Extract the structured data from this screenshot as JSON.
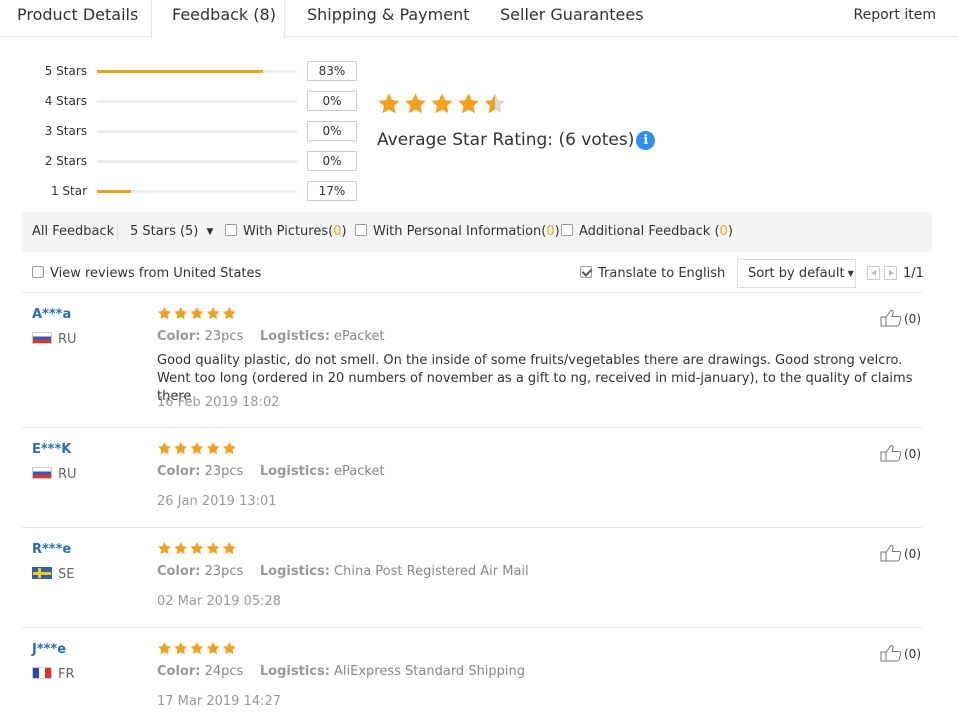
{
  "tabs": [
    {
      "label": "Product Details"
    },
    {
      "label": "Feedback (8)"
    },
    {
      "label": "Shipping & Payment"
    },
    {
      "label": "Seller Guarantees"
    }
  ],
  "report_item": "Report item",
  "rating_distribution": [
    {
      "label": "5 Stars",
      "percent_text": "83%",
      "fraction": 0.83
    },
    {
      "label": "4 Stars",
      "percent_text": "0%",
      "fraction": 0.0
    },
    {
      "label": "3 Stars",
      "percent_text": "0%",
      "fraction": 0.0
    },
    {
      "label": "2 Stars",
      "percent_text": "0%",
      "fraction": 0.0
    },
    {
      "label": "1 Star",
      "percent_text": "17%",
      "fraction": 0.17
    }
  ],
  "average": {
    "label": "Average Star Rating:",
    "votes": "(6 votes)",
    "star_value": 4.5,
    "info_icon": "i"
  },
  "filters": {
    "all_feedback": "All Feedback",
    "star_select": "5 Stars (5)",
    "with_pictures": {
      "label": "With Pictures",
      "count": "0",
      "checked": false
    },
    "with_personal_info": {
      "label": "With Personal Information",
      "count": "0",
      "checked": false
    },
    "additional_feedback": {
      "label": "Additional Feedback",
      "count": "0",
      "checked": false
    }
  },
  "options": {
    "view_country": {
      "label": "View reviews from United States",
      "checked": false
    },
    "translate": {
      "label": "Translate to English",
      "checked": true
    },
    "sort": "Sort by default",
    "page": "1/1"
  },
  "colors": {
    "star": "#f3a01c",
    "star_empty": "#d9d9d9",
    "username": "#2a6db4",
    "info": "#2e8def"
  },
  "reviews": [
    {
      "user": "A***a",
      "country": "RU",
      "flag": "russia-flag",
      "stars": 5,
      "color_label": "Color:",
      "color_value": "23pcs",
      "logistics_label": "Logistics:",
      "logistics_value": "ePacket",
      "text": "Good quality plastic, do not smell. On the inside of some fruits/vegetables there are drawings. Good strong velcro. Went too long (ordered in 20 numbers of november as a gift to ng, received in mid-january), to the quality of claims there",
      "date": "16 Feb 2019 18:02",
      "likes": "(0)"
    },
    {
      "user": "E***K",
      "country": "RU",
      "flag": "russia-flag",
      "stars": 5,
      "color_label": "Color:",
      "color_value": "23pcs",
      "logistics_label": "Logistics:",
      "logistics_value": "ePacket",
      "text": "",
      "date": "26 Jan 2019 13:01",
      "likes": "(0)"
    },
    {
      "user": "R***e",
      "country": "SE",
      "flag": "sweden-flag",
      "stars": 5,
      "color_label": "Color:",
      "color_value": "23pcs",
      "logistics_label": "Logistics:",
      "logistics_value": "China Post Registered Air Mail",
      "text": "",
      "date": "02 Mar 2019 05:28",
      "likes": "(0)"
    },
    {
      "user": "J***e",
      "country": "FR",
      "flag": "france-flag",
      "stars": 5,
      "color_label": "Color:",
      "color_value": "24pcs",
      "logistics_label": "Logistics:",
      "logistics_value": "AliExpress Standard Shipping",
      "text": "",
      "date": "17 Mar 2019 14:27",
      "likes": "(0)"
    }
  ]
}
